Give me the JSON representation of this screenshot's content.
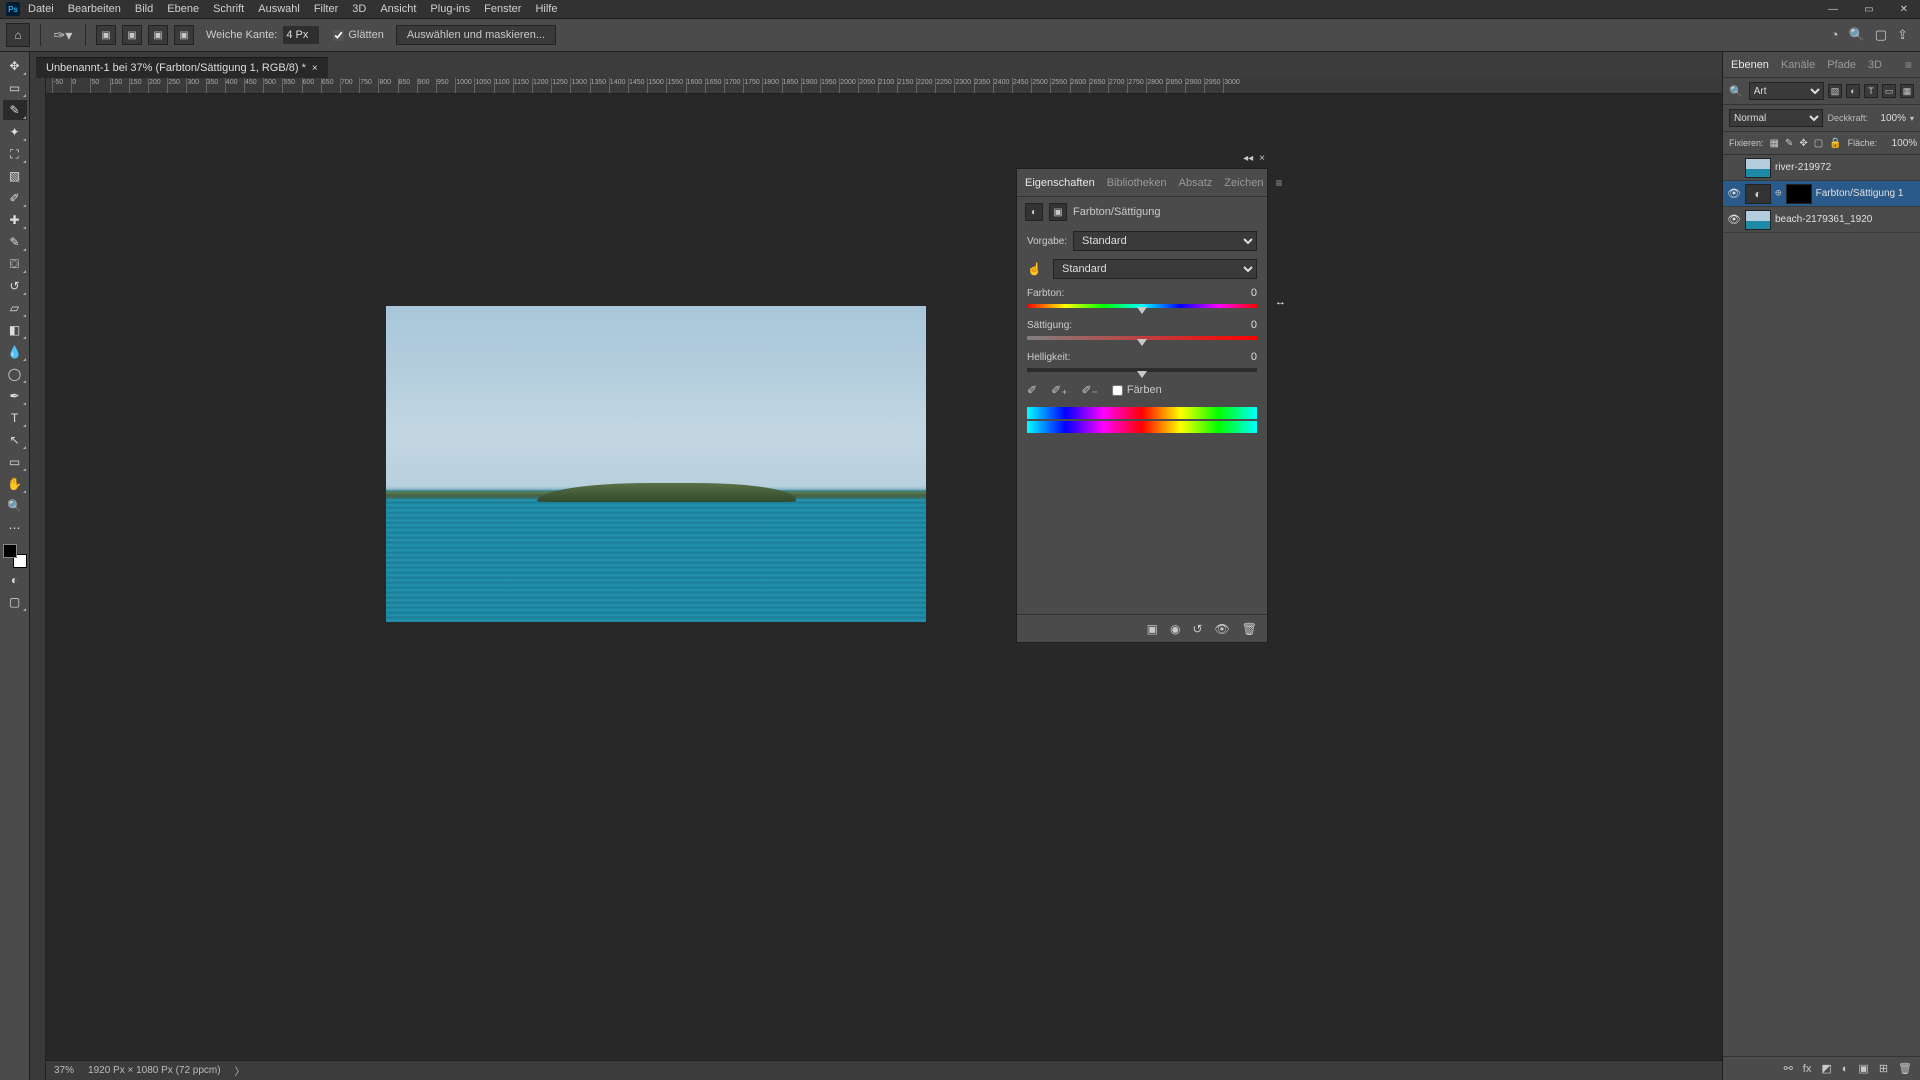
{
  "menu": [
    "Datei",
    "Bearbeiten",
    "Bild",
    "Ebene",
    "Schrift",
    "Auswahl",
    "Filter",
    "3D",
    "Ansicht",
    "Plug-ins",
    "Fenster",
    "Hilfe"
  ],
  "options": {
    "feather_label": "Weiche Kante:",
    "feather_value": "4 Px",
    "antialias": "Glätten",
    "mask_button": "Auswählen und maskieren..."
  },
  "doc_tab": "Unbenannt-1 bei 37% (Farbton/Sättigung 1, RGB/8) *",
  "ruler_h": [
    "-50",
    "0",
    "50",
    "100",
    "150",
    "200",
    "250",
    "300",
    "350",
    "400",
    "450",
    "500",
    "550",
    "600",
    "650",
    "700",
    "750",
    "800",
    "850",
    "900",
    "950",
    "1000",
    "1050",
    "1100",
    "1150",
    "1200",
    "1250",
    "1300",
    "1350",
    "1400",
    "1450",
    "1500",
    "1550",
    "1600",
    "1650",
    "1700",
    "1750",
    "1800",
    "1850",
    "1900",
    "1950",
    "2000",
    "2050",
    "2100",
    "2150",
    "2200",
    "2250",
    "2300",
    "2350",
    "2400",
    "2450",
    "2500",
    "2550",
    "2600",
    "2650",
    "2700",
    "2750",
    "2800",
    "2850",
    "2900",
    "2950",
    "3000"
  ],
  "status": {
    "zoom": "37%",
    "docinfo": "1920 Px × 1080 Px (72 ppcm)"
  },
  "props": {
    "tabs": [
      "Eigenschaften",
      "Bibliotheken",
      "Absatz",
      "Zeichen"
    ],
    "title": "Farbton/Sättigung",
    "preset_label": "Vorgabe:",
    "preset_value": "Standard",
    "channel_value": "Standard",
    "hue_label": "Farbton:",
    "hue_value": "0",
    "sat_label": "Sättigung:",
    "sat_value": "0",
    "light_label": "Helligkeit:",
    "light_value": "0",
    "colorize": "Färben"
  },
  "layers_panel": {
    "tabs": [
      "Ebenen",
      "Kanäle",
      "Pfade",
      "3D"
    ],
    "search_type": "Art",
    "blend_mode": "Normal",
    "opacity_label": "Deckkraft:",
    "opacity_value": "100%",
    "lock_label": "Fixieren:",
    "fill_label": "Fläche:",
    "fill_value": "100%",
    "layers": [
      {
        "visible": false,
        "type": "image",
        "name": "river-219972"
      },
      {
        "visible": true,
        "type": "adjustment",
        "name": "Farbton/Sättigung 1",
        "selected": true,
        "mask": true
      },
      {
        "visible": true,
        "type": "image",
        "name": "beach-2179361_1920"
      }
    ]
  }
}
